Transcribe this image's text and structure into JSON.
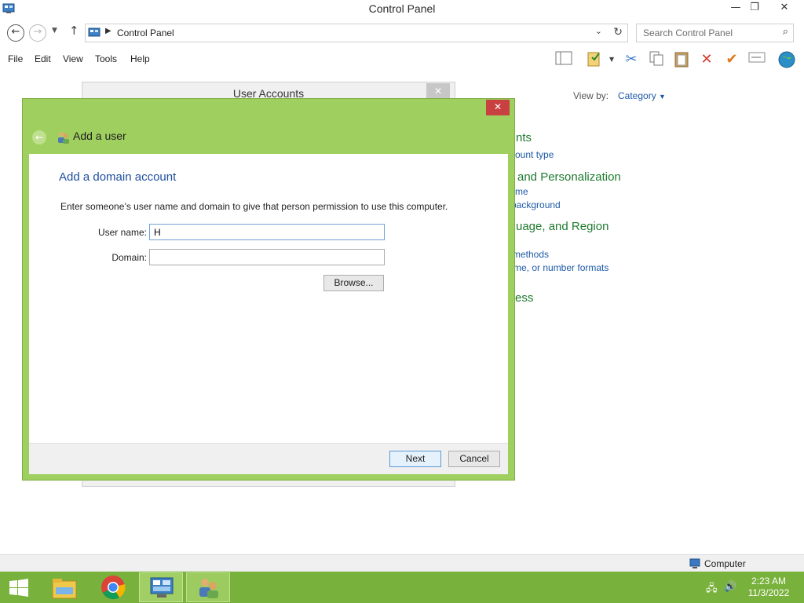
{
  "window": {
    "title": "Control Panel",
    "controls": {
      "minimize": "—",
      "restore": "❐",
      "close": "✕"
    }
  },
  "address": {
    "breadcrumb": "Control Panel",
    "search_placeholder": "Search Control Panel"
  },
  "menu": [
    "File",
    "Edit",
    "View",
    "Tools",
    "Help"
  ],
  "toolbar_icons": [
    "layout-icon",
    "properties-icon",
    "cut-icon",
    "copy-icon",
    "paste-icon",
    "delete-icon",
    "checkmark-icon",
    "rename-icon",
    "globe-icon"
  ],
  "content": {
    "view_by_label": "View by:",
    "view_by_value": "Category",
    "partial_items": [
      {
        "kind": "head",
        "text": "nts"
      },
      {
        "kind": "link",
        "text": "ount type"
      },
      {
        "kind": "head",
        "text": "and Personalization"
      },
      {
        "kind": "link",
        "text": "me"
      },
      {
        "kind": "link",
        "text": "background"
      },
      {
        "kind": "head",
        "text": "uage, and Region"
      },
      {
        "kind": "link",
        "text": "methods"
      },
      {
        "kind": "link",
        "text": "me, or number formats"
      },
      {
        "kind": "head",
        "text": "ess"
      }
    ]
  },
  "user_accounts_window": {
    "title": "User Accounts",
    "close": "✕"
  },
  "dialog": {
    "close": "✕",
    "title": "Add a user",
    "heading": "Add a domain account",
    "instructions": "Enter someone’s user name and domain to give that person permission to use this computer.",
    "username_label": "User name:",
    "username_value": "H",
    "domain_label": "Domain:",
    "domain_value": "",
    "browse_label": "Browse...",
    "next_label": "Next",
    "cancel_label": "Cancel"
  },
  "statusbar": {
    "computer_label": "Computer"
  },
  "taskbar": {
    "buttons": [
      "start-button",
      "file-explorer",
      "chrome",
      "control-panel",
      "user-accounts"
    ],
    "time": "2:23 AM",
    "date": "11/3/2022"
  },
  "colors": {
    "dialog_accent": "#9fcf5e",
    "taskbar": "#78b13b",
    "link": "#1e5aa8",
    "category_heading": "#1d7a2e",
    "close_red": "#c94040"
  }
}
